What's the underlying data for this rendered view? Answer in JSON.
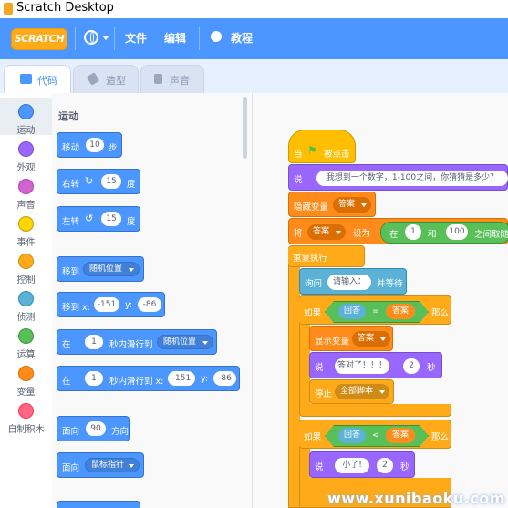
{
  "window": {
    "title": "Scratch Desktop"
  },
  "menubar": {
    "logo": "SCRATCH",
    "file": "文件",
    "edit": "编辑",
    "tutorials": "教程"
  },
  "tabs": [
    {
      "label": "代码"
    },
    {
      "label": "造型"
    },
    {
      "label": "声音"
    }
  ],
  "categories": [
    {
      "label": "运动",
      "color": "#4c97ff"
    },
    {
      "label": "外观",
      "color": "#9966ff"
    },
    {
      "label": "声音",
      "color": "#cf63cf"
    },
    {
      "label": "事件",
      "color": "#ffd500"
    },
    {
      "label": "控制",
      "color": "#ffab19"
    },
    {
      "label": "侦测",
      "color": "#5cb1d6"
    },
    {
      "label": "运算",
      "color": "#59c059"
    },
    {
      "label": "变量",
      "color": "#ff8c1a"
    },
    {
      "label": "自制积木",
      "color": "#ff6680"
    }
  ],
  "palette": {
    "section": "运动",
    "move": {
      "pre": "移动",
      "val": "10",
      "post": "步"
    },
    "turn_right": {
      "pre": "右转",
      "val": "15",
      "post": "度"
    },
    "turn_left": {
      "pre": "左转",
      "val": "15",
      "post": "度"
    },
    "goto": {
      "pre": "移到",
      "dd": "随机位置"
    },
    "goto_xy": {
      "pre": "移到 x:",
      "x": "-151",
      "ylabel": "y:",
      "y": "-86"
    },
    "glide": {
      "pre": "在",
      "val": "1",
      "mid": "秒内滑行到",
      "dd": "随机位置"
    },
    "glide_xy": {
      "pre": "在",
      "val": "1",
      "mid": "秒内滑行到 x:",
      "x": "-151",
      "ylabel": "y:",
      "y": "-86"
    },
    "point_dir": {
      "pre": "面向",
      "val": "90",
      "post": "方向"
    },
    "point_towards": {
      "pre": "面向",
      "dd": "鼠标指针"
    }
  },
  "script": {
    "hat": {
      "pre": "当",
      "post": "被点击"
    },
    "say1": {
      "pre": "说",
      "val": "我想到一个数字，1-100之间，你猜猜是多少？"
    },
    "hide_var": {
      "pre": "隐藏变量",
      "dd": "答案"
    },
    "set_var": {
      "pre": "将",
      "dd": "答案",
      "mid": "设为",
      "rand_pre": "在",
      "a": "1",
      "and": "和",
      "b": "100",
      "rand_post": "之间取随"
    },
    "forever": {
      "label": "重复执行"
    },
    "ask": {
      "pre": "询问",
      "val": "请输入：",
      "post": "并等待"
    },
    "if1": {
      "pre": "如果",
      "left": "回答",
      "op": "=",
      "right": "答案",
      "post": "那么"
    },
    "show_var": {
      "pre": "显示变量",
      "dd": "答案"
    },
    "say2": {
      "pre": "说",
      "val": "答对了！！！",
      "num": "2",
      "post": "秒"
    },
    "stop": {
      "pre": "停止",
      "dd": "全部脚本"
    },
    "if2": {
      "pre": "如果",
      "left": "回答",
      "op": "<",
      "right": "答案",
      "post": "那么"
    },
    "say3": {
      "pre": "说",
      "val": "小了!",
      "num": "2",
      "post": "秒"
    }
  },
  "watermark": "www.xunibaoku.com"
}
